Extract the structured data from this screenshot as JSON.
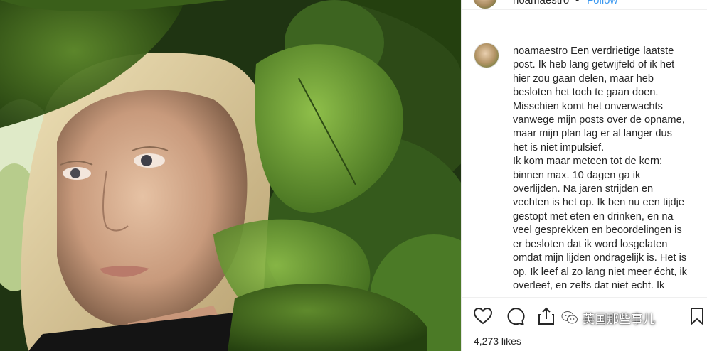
{
  "header": {
    "username": "noamaestro",
    "separator": "•",
    "follow_label": "Follow"
  },
  "caption": {
    "username": "noamaestro",
    "lines": [
      " Een verdrietige laatste",
      "post. Ik heb lang getwijfeld of ik het",
      "hier zou gaan delen, maar heb",
      "besloten het toch te gaan doen.",
      "Misschien komt het onverwachts",
      "vanwege mijn posts over de opname,",
      "maar mijn plan lag er al langer dus",
      "het is niet impulsief.",
      "Ik kom maar meteen tot de kern:",
      "binnen max. 10 dagen ga ik",
      "overlijden. Na jaren strijden en",
      "vechten is het op. Ik ben nu een tijdje",
      "gestopt met eten en drinken, en na",
      "veel gesprekken en beoordelingen is",
      "er besloten dat ik word losgelaten",
      "omdat mijn lijden ondragelijk is. Het is",
      "op. Ik leef al zo lang niet meer écht, ik",
      "overleef, en zelfs dat niet echt. Ik"
    ]
  },
  "actions": {
    "like_icon": "heart-icon",
    "comment_icon": "comment-icon",
    "share_icon": "share-icon",
    "save_icon": "bookmark-icon"
  },
  "likes_text": "4,273 likes",
  "watermark": {
    "text": "英国那些事儿",
    "logo_icon": "wechat-logo-icon"
  },
  "photo": {
    "description_icon": "post-photo"
  },
  "colors": {
    "link": "#3897f0",
    "text": "#262626",
    "divider": "#efefef"
  }
}
